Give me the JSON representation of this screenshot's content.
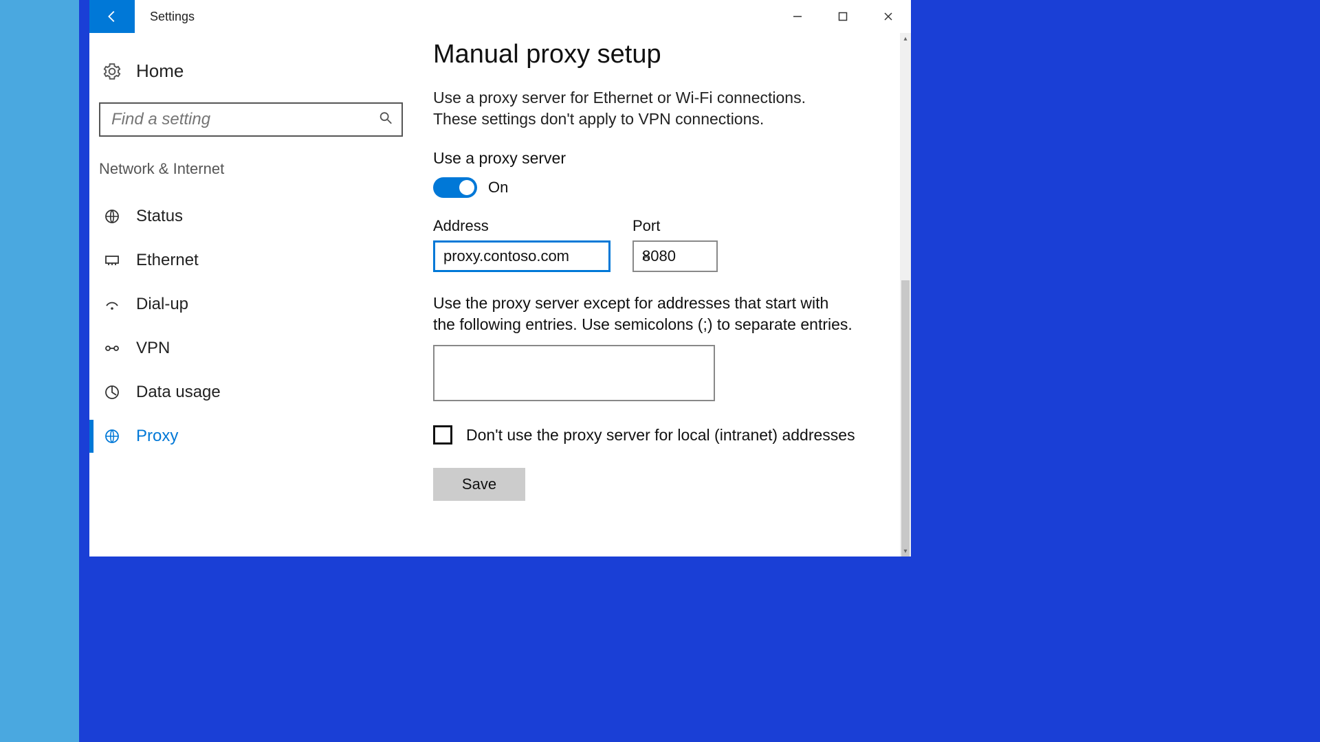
{
  "window": {
    "title": "Settings"
  },
  "sidebar": {
    "home_label": "Home",
    "search_placeholder": "Find a setting",
    "section_label": "Network & Internet",
    "items": [
      {
        "label": "Status"
      },
      {
        "label": "Ethernet"
      },
      {
        "label": "Dial-up"
      },
      {
        "label": "VPN"
      },
      {
        "label": "Data usage"
      },
      {
        "label": "Proxy"
      }
    ]
  },
  "main": {
    "heading": "Manual proxy setup",
    "description": "Use a proxy server for Ethernet or Wi-Fi connections. These settings don't apply to VPN connections.",
    "toggle_label": "Use a proxy server",
    "toggle_state": "On",
    "address_label": "Address",
    "address_value": "proxy.contoso.com",
    "port_label": "Port",
    "port_value": "8080",
    "except_description": "Use the proxy server except for addresses that start with the following entries. Use semicolons (;) to separate entries.",
    "except_value": "",
    "checkbox_label": "Don't use the proxy server for local (intranet) addresses",
    "save_label": "Save"
  }
}
